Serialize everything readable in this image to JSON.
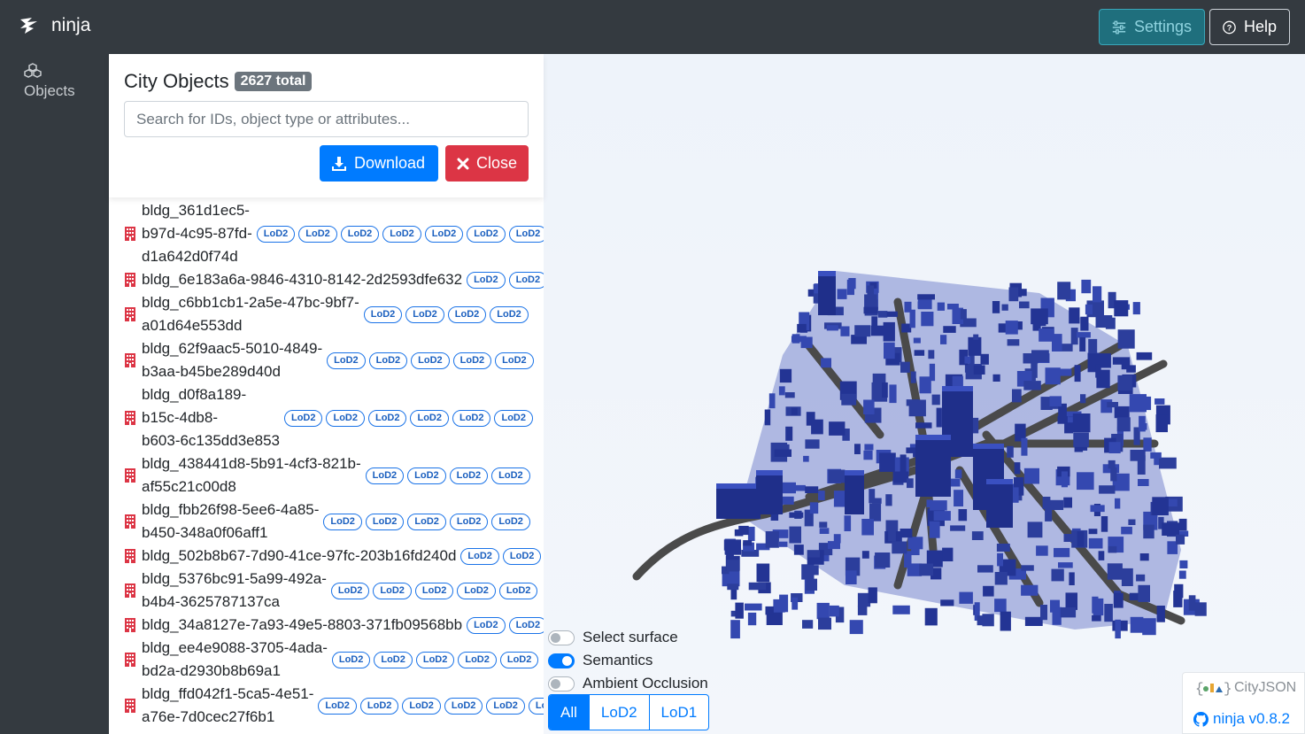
{
  "navbar": {
    "brand": "ninja",
    "settings_label": "Settings",
    "help_label": "Help"
  },
  "sidebar": {
    "items": [
      {
        "label": "Objects",
        "icon": "objects-icon"
      }
    ]
  },
  "panel": {
    "title": "City Objects",
    "total_badge": "2627 total",
    "search_placeholder": "Search for IDs, object type or attributes...",
    "download_label": "Download",
    "close_label": "Close"
  },
  "objects": [
    {
      "lines": [
        "bldg_361d1ec5-",
        "b97d-4c95-87fd-",
        "d1a642d0f74d"
      ],
      "lod": "LoD2"
    },
    {
      "lines": [
        "bldg_6e183a6a-9846-4310-8142-2d2593dfe632"
      ],
      "lod": "LoD2"
    },
    {
      "lines": [
        "bldg_c6bb1cb1-2a5e-47bc-9bf7-",
        "a01d64e553dd"
      ],
      "lod": "LoD2"
    },
    {
      "lines": [
        "bldg_62f9aac5-5010-4849-",
        "b3aa-b45be289d40d"
      ],
      "lod": "LoD2"
    },
    {
      "lines": [
        "bldg_d0f8a189-",
        "b15c-4db8-",
        "b603-6c135dd3e853"
      ],
      "lod": "LoD2"
    },
    {
      "lines": [
        "bldg_438441d8-5b91-4cf3-821b-",
        "af55c21c00d8"
      ],
      "lod": "LoD2"
    },
    {
      "lines": [
        "bldg_fbb26f98-5ee6-4a85-",
        "b450-348a0f06aff1"
      ],
      "lod": "LoD2"
    },
    {
      "lines": [
        "bldg_502b8b67-7d90-41ce-97fc-203b16fd240d"
      ],
      "lod": "LoD2"
    },
    {
      "lines": [
        "bldg_5376bc91-5a99-492a-",
        "b4b4-3625787137ca"
      ],
      "lod": "LoD2"
    },
    {
      "lines": [
        "bldg_34a8127e-7a93-49e5-8803-371fb09568bb"
      ],
      "lod": "LoD2"
    },
    {
      "lines": [
        "bldg_ee4e9088-3705-4ada-",
        "bd2a-d2930b8b69a1"
      ],
      "lod": "LoD2"
    },
    {
      "lines": [
        "bldg_ffd042f1-5ca5-4e51-",
        "a76e-7d0cec27f6b1"
      ],
      "lod": "LoD2"
    }
  ],
  "viewer": {
    "toggles": [
      {
        "label": "Select surface",
        "on": false
      },
      {
        "label": "Semantics",
        "on": true
      },
      {
        "label": "Ambient Occlusion",
        "on": false
      }
    ],
    "lod_filter": [
      "All",
      "LoD2",
      "LoD1"
    ],
    "lod_selected": "All",
    "building_color": "#2c3e9c",
    "road_color": "#4a4a4a"
  },
  "credits": {
    "cityjson": "CityJSON",
    "version": "ninja v0.8.2"
  },
  "colors": {
    "navbar": "#343a40",
    "primary": "#007bff",
    "danger": "#dc3545",
    "building_icon": "#dc3545"
  }
}
